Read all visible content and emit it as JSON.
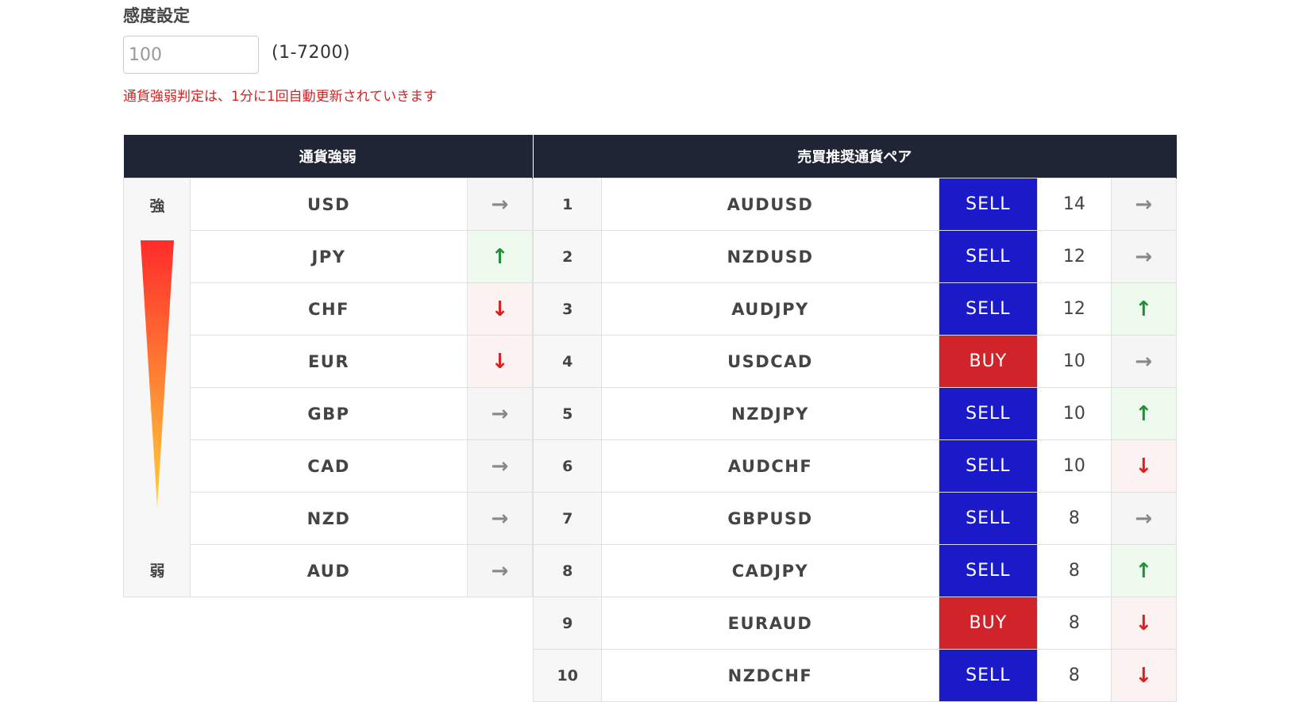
{
  "settings": {
    "title": "感度設定",
    "input_placeholder": "100",
    "range": "(1-7200)",
    "notice": "通貨強弱判定は、1分に1回自動更新されていきます"
  },
  "strength": {
    "header": "通貨強弱",
    "strong_label": "強",
    "weak_label": "弱",
    "gauge_colors": {
      "top": "#ff2b2b",
      "bottom": "#ffd23a"
    },
    "rows": [
      {
        "currency": "USD",
        "trend": "flat",
        "icon": "→"
      },
      {
        "currency": "JPY",
        "trend": "up",
        "icon": "↑"
      },
      {
        "currency": "CHF",
        "trend": "down",
        "icon": "↓"
      },
      {
        "currency": "EUR",
        "trend": "down",
        "icon": "↓"
      },
      {
        "currency": "GBP",
        "trend": "flat",
        "icon": "→"
      },
      {
        "currency": "CAD",
        "trend": "flat",
        "icon": "→"
      },
      {
        "currency": "NZD",
        "trend": "flat",
        "icon": "→"
      },
      {
        "currency": "AUD",
        "trend": "flat",
        "icon": "→"
      }
    ]
  },
  "pairs": {
    "header": "売買推奨通貨ペア",
    "colors": {
      "sell": "#1a1ac8",
      "buy": "#d0242a"
    },
    "rows": [
      {
        "rank": "1",
        "pair": "AUDUSD",
        "signal": "SELL",
        "score": "14",
        "trend": "flat",
        "icon": "→"
      },
      {
        "rank": "2",
        "pair": "NZDUSD",
        "signal": "SELL",
        "score": "12",
        "trend": "flat",
        "icon": "→"
      },
      {
        "rank": "3",
        "pair": "AUDJPY",
        "signal": "SELL",
        "score": "12",
        "trend": "up",
        "icon": "↑"
      },
      {
        "rank": "4",
        "pair": "USDCAD",
        "signal": "BUY",
        "score": "10",
        "trend": "flat",
        "icon": "→"
      },
      {
        "rank": "5",
        "pair": "NZDJPY",
        "signal": "SELL",
        "score": "10",
        "trend": "up",
        "icon": "↑"
      },
      {
        "rank": "6",
        "pair": "AUDCHF",
        "signal": "SELL",
        "score": "10",
        "trend": "down",
        "icon": "↓"
      },
      {
        "rank": "7",
        "pair": "GBPUSD",
        "signal": "SELL",
        "score": "8",
        "trend": "flat",
        "icon": "→"
      },
      {
        "rank": "8",
        "pair": "CADJPY",
        "signal": "SELL",
        "score": "8",
        "trend": "up",
        "icon": "↑"
      },
      {
        "rank": "9",
        "pair": "EURAUD",
        "signal": "BUY",
        "score": "8",
        "trend": "down",
        "icon": "↓"
      },
      {
        "rank": "10",
        "pair": "NZDCHF",
        "signal": "SELL",
        "score": "8",
        "trend": "down",
        "icon": "↓"
      }
    ]
  }
}
